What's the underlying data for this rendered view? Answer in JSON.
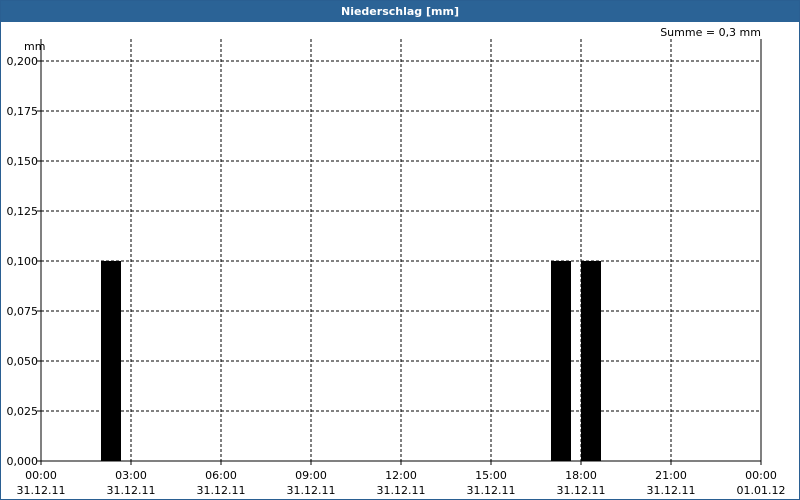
{
  "window": {
    "title": "Niederschlag [mm]"
  },
  "chart_data": {
    "type": "bar",
    "title": "Niederschlag [mm]",
    "ylabel": "mm",
    "summary": "Summe = 0,3 mm",
    "ylim": [
      0,
      0.2
    ],
    "y_ticks": [
      "0,000",
      "0,025",
      "0,050",
      "0,075",
      "0,100",
      "0,125",
      "0,150",
      "0,175",
      "0,200"
    ],
    "x_ticks": [
      {
        "time": "00:00",
        "date": "31.12.11"
      },
      {
        "time": "03:00",
        "date": "31.12.11"
      },
      {
        "time": "06:00",
        "date": "31.12.11"
      },
      {
        "time": "09:00",
        "date": "31.12.11"
      },
      {
        "time": "12:00",
        "date": "31.12.11"
      },
      {
        "time": "15:00",
        "date": "31.12.11"
      },
      {
        "time": "18:00",
        "date": "31.12.11"
      },
      {
        "time": "21:00",
        "date": "31.12.11"
      },
      {
        "time": "00:00",
        "date": "01.01.12"
      }
    ],
    "xlim": [
      "31.12.11 00:00",
      "01.01.12 00:00"
    ],
    "grid": true,
    "bar_color": "#000000",
    "bars": [
      {
        "start": "31.12.11 02:00",
        "end": "31.12.11 02:40",
        "value": 0.1
      },
      {
        "start": "31.12.11 17:00",
        "end": "31.12.11 17:40",
        "value": 0.1
      },
      {
        "start": "31.12.11 18:00",
        "end": "31.12.11 18:40",
        "value": 0.1
      }
    ]
  }
}
